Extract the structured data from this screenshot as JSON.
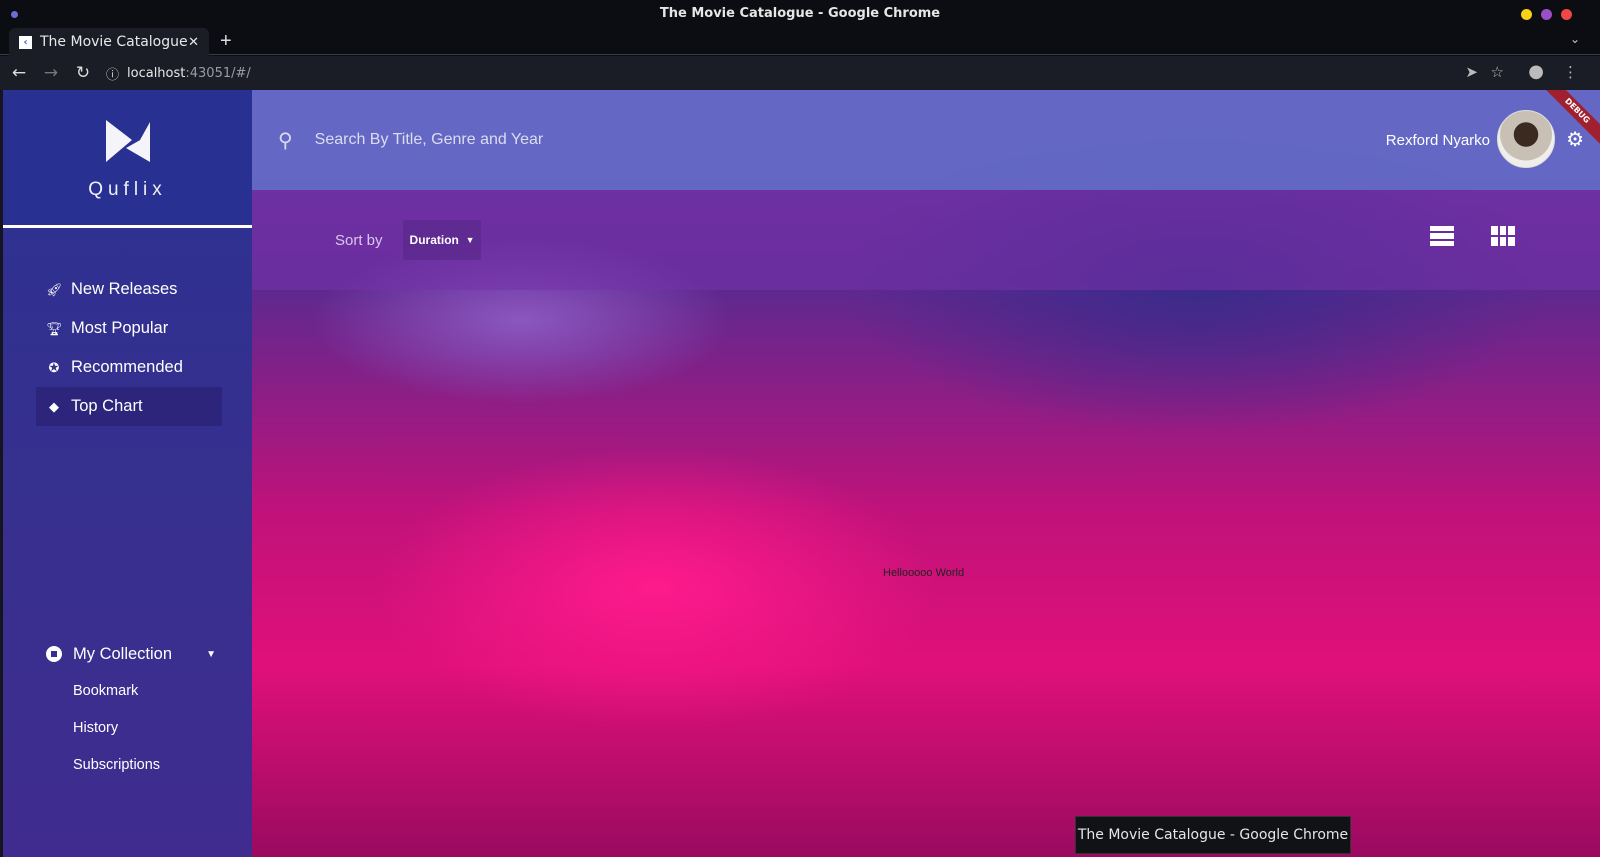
{
  "window": {
    "title": "The Movie Catalogue - Google Chrome",
    "controls_colors": [
      "#f7d117",
      "#9b4fc4",
      "#f04646"
    ]
  },
  "browser": {
    "tab_title": "The Movie Catalogue",
    "url_host": "localhost",
    "url_rest": ":43051/#/",
    "tooltip": "The Movie Catalogue - Google Chrome"
  },
  "sidebar": {
    "brand": "Quflix",
    "items": [
      {
        "label": "New Releases",
        "icon": "rocket-icon"
      },
      {
        "label": "Most Popular",
        "icon": "trophy-icon"
      },
      {
        "label": "Recommended",
        "icon": "verified-icon"
      },
      {
        "label": "Top Chart",
        "icon": "diamond-icon",
        "active": true
      }
    ],
    "collection": {
      "label": "My Collection",
      "items": [
        "Bookmark",
        "History",
        "Subscriptions"
      ]
    }
  },
  "header": {
    "search_placeholder": "Search By Title, Genre and Year",
    "user_name": "Rexford Nyarko",
    "debug_banner": "DEBUG"
  },
  "sortbar": {
    "label": "Sort by",
    "selected": "Duration"
  },
  "content": {
    "text": "Hellooooo World"
  }
}
